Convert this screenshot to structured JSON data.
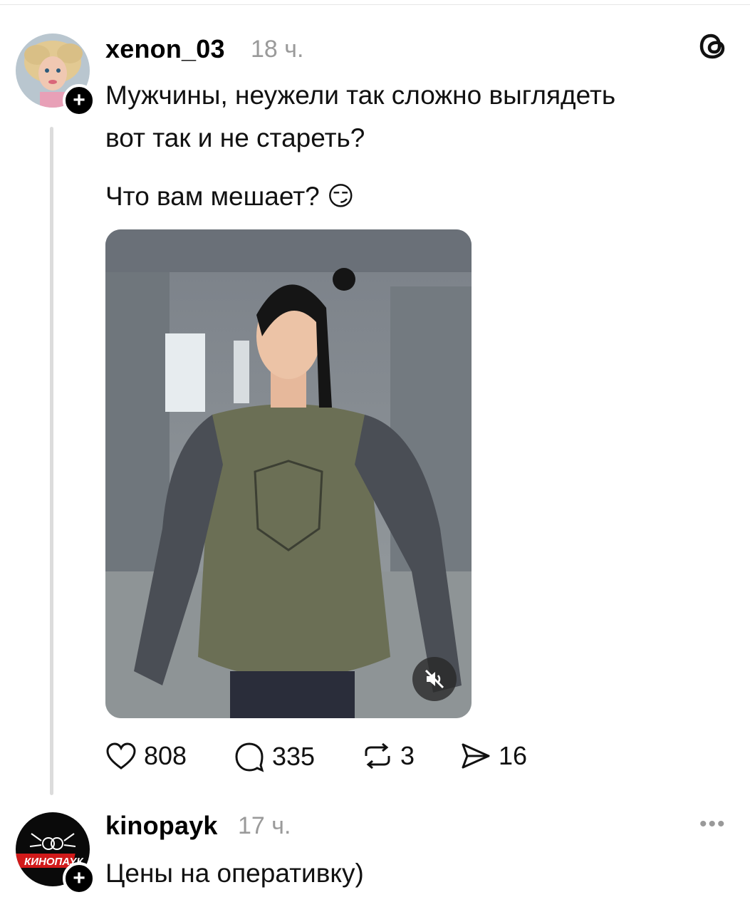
{
  "post": {
    "username": "xenon_03",
    "time": "18 ч.",
    "text_line1": "Мужчины, неужели так сложно выглядеть",
    "text_line2": "вот так и не стареть?",
    "text_line3": "Что вам мешает? 😏",
    "likes": "808",
    "comments": "335",
    "reposts": "3",
    "shares": "16",
    "avatar_icon": "doll-avatar",
    "media_icon": "muted-speaker-icon"
  },
  "reply": {
    "username": "kinopayk",
    "time": "17 ч.",
    "text": "Цены на оперативку)",
    "more": "•••"
  },
  "app": {
    "logo_icon": "threads-logo-icon",
    "follow_symbol": "+"
  },
  "colors": {
    "accent": "#000000",
    "muted_text": "#9a9a9a",
    "thread_line": "#dcdcdc",
    "shirt": "#6b6f55",
    "sleeve": "#4a4e55"
  }
}
